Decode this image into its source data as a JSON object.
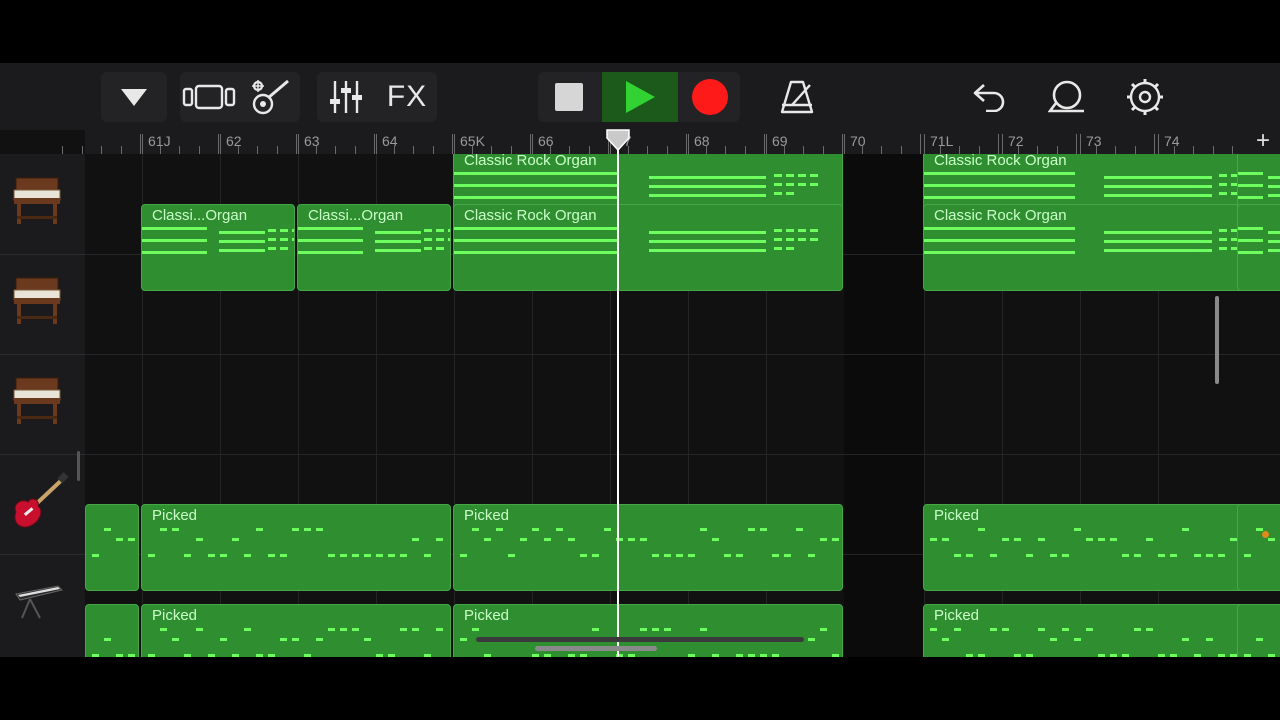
{
  "toolbar": {
    "fx_label": "FX",
    "record_color": "#ff1a1a",
    "play_color": "#32d232",
    "icons": [
      "browser-dropdown-icon",
      "tracks-view-icon",
      "smart-controls-icon",
      "mixer-icon",
      "fx-label",
      "stop-icon",
      "play-icon",
      "record-icon",
      "metronome-icon",
      "undo-icon",
      "loop-browser-icon",
      "settings-icon"
    ]
  },
  "ruler": {
    "labels": [
      "61J",
      "62",
      "63",
      "64",
      "65K",
      "66",
      "67",
      "68",
      "69",
      "70",
      "71L",
      "72",
      "73",
      "74"
    ],
    "add_label": "+"
  },
  "tracks": [
    {
      "instrument": "organ-icon",
      "regions": [
        {
          "name": "Classic Rock Organ"
        },
        {
          "name": "Classic Rock Organ"
        }
      ]
    },
    {
      "instrument": "organ-icon",
      "regions": [
        {
          "name": "Classi...Organ"
        },
        {
          "name": "Classi...Organ"
        },
        {
          "name": "Classic Rock Organ"
        },
        {
          "name": "Classic Rock Organ"
        }
      ]
    },
    {
      "instrument": "organ-icon",
      "regions": []
    },
    {
      "instrument": "electric-guitar-icon",
      "regions": [
        {
          "name": "Picked"
        },
        {
          "name": "Picked"
        },
        {
          "name": "Picked"
        }
      ]
    },
    {
      "instrument": "keyboard-icon",
      "regions": [
        {
          "name": "Picked"
        },
        {
          "name": "Picked"
        },
        {
          "name": "Picked"
        }
      ]
    }
  ],
  "colors": {
    "region": "#2f8e2f",
    "note": "#6cff5e"
  }
}
